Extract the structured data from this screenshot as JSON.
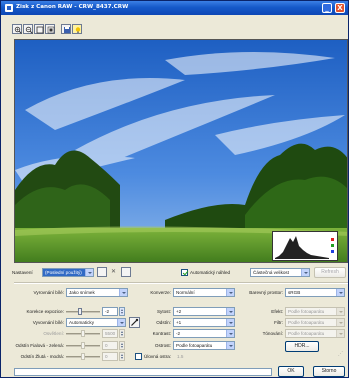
{
  "window": {
    "title": "Zisk z Canon RAW - CRW_8437.CRW",
    "min_label": "_",
    "close_label": "X"
  },
  "toolbar": {
    "icons": [
      "zoom-in-icon",
      "zoom-out-icon",
      "fit-icon",
      "actual-size-icon",
      "save-icon",
      "light-icon"
    ]
  },
  "settings_row": {
    "nastaveni_label": "Nastavení",
    "preset_value": "(Poslední použitý)",
    "auto_preview_label": "Automatický náhled",
    "auto_preview_checked": true,
    "size_value": "Částečná velikost",
    "refresh_label": "Refresh"
  },
  "col1": {
    "white_balance_label": "Vyrovnání bílé:",
    "white_balance_value": "Jako snímek",
    "exposure_label": "Korekce expozice:",
    "exposure_value": "-2",
    "white_point_label": "Vyvovnání bílé:",
    "white_point_value": "Automaticky",
    "brightness_label": "Osvětlení:",
    "brightness_value": "5500",
    "red_green_label": "Odstín Fialová - zelená:",
    "red_green_value": "0",
    "blue_yellow_label": "Odstín Žlutá - modrá:",
    "blue_yellow_value": "0"
  },
  "col2": {
    "conversion_label": "Konverze:",
    "conversion_value": "Normální",
    "saturation_label": "Sytost:",
    "saturation_value": "+2",
    "contrast_label": "Odstín:",
    "contrast_value": "+1",
    "tone_label": "Kontrast:",
    "tone_value": "-2",
    "sharpness_label": "Ostrost:",
    "sharpness_value": "Podle fotoaparátu",
    "linear_label": "Úlovná ostra:",
    "linear_value": "1.5"
  },
  "col3": {
    "color_space_label": "Barevný prostor:",
    "color_space_value": "sRGB",
    "effect_label": "Efekt:",
    "effect_value": "Podle fotoaparátu",
    "filter_label": "Filtr:",
    "filter_value": "Podle fotoaparátu",
    "toning_label": "Tónování:",
    "toning_value": "Podle fotoaparátu",
    "hdr_label": "HDR..."
  },
  "footer": {
    "ok_label": "OK",
    "cancel_label": "Storno"
  },
  "colors": {
    "title_bar": "#0d47b5",
    "window_bg": "#ece9d8",
    "field_border": "#7f9db9",
    "selected_bg": "#316ac5"
  }
}
